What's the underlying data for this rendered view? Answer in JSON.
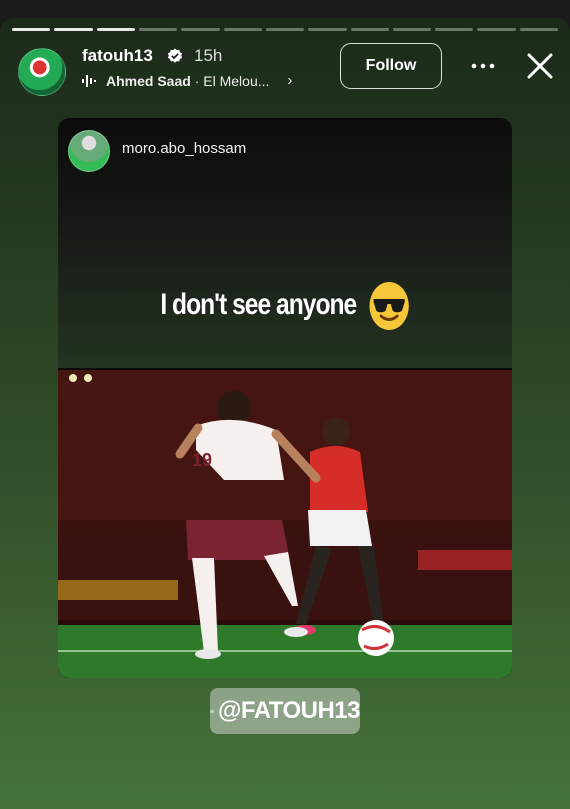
{
  "story": {
    "segments_total": 13,
    "segments_viewed": 3,
    "author": {
      "username": "fatouh13",
      "verified": true,
      "time_ago": "15h"
    },
    "music": {
      "artist": "Ahmed Saad",
      "track": "El Melou..."
    },
    "follow_label": "Follow"
  },
  "shared_post": {
    "username": "moro.abo_hossam",
    "caption": "I don't see anyone",
    "caption_emoji": "smiling-face-with-sunglasses",
    "photo": {
      "jersey_number": "19"
    }
  },
  "mention": {
    "label": "@FATOUH13"
  },
  "colors": {
    "background_top": "#1c2a1a",
    "background_bottom": "#46723a",
    "verified_blue": "#3897f0"
  }
}
